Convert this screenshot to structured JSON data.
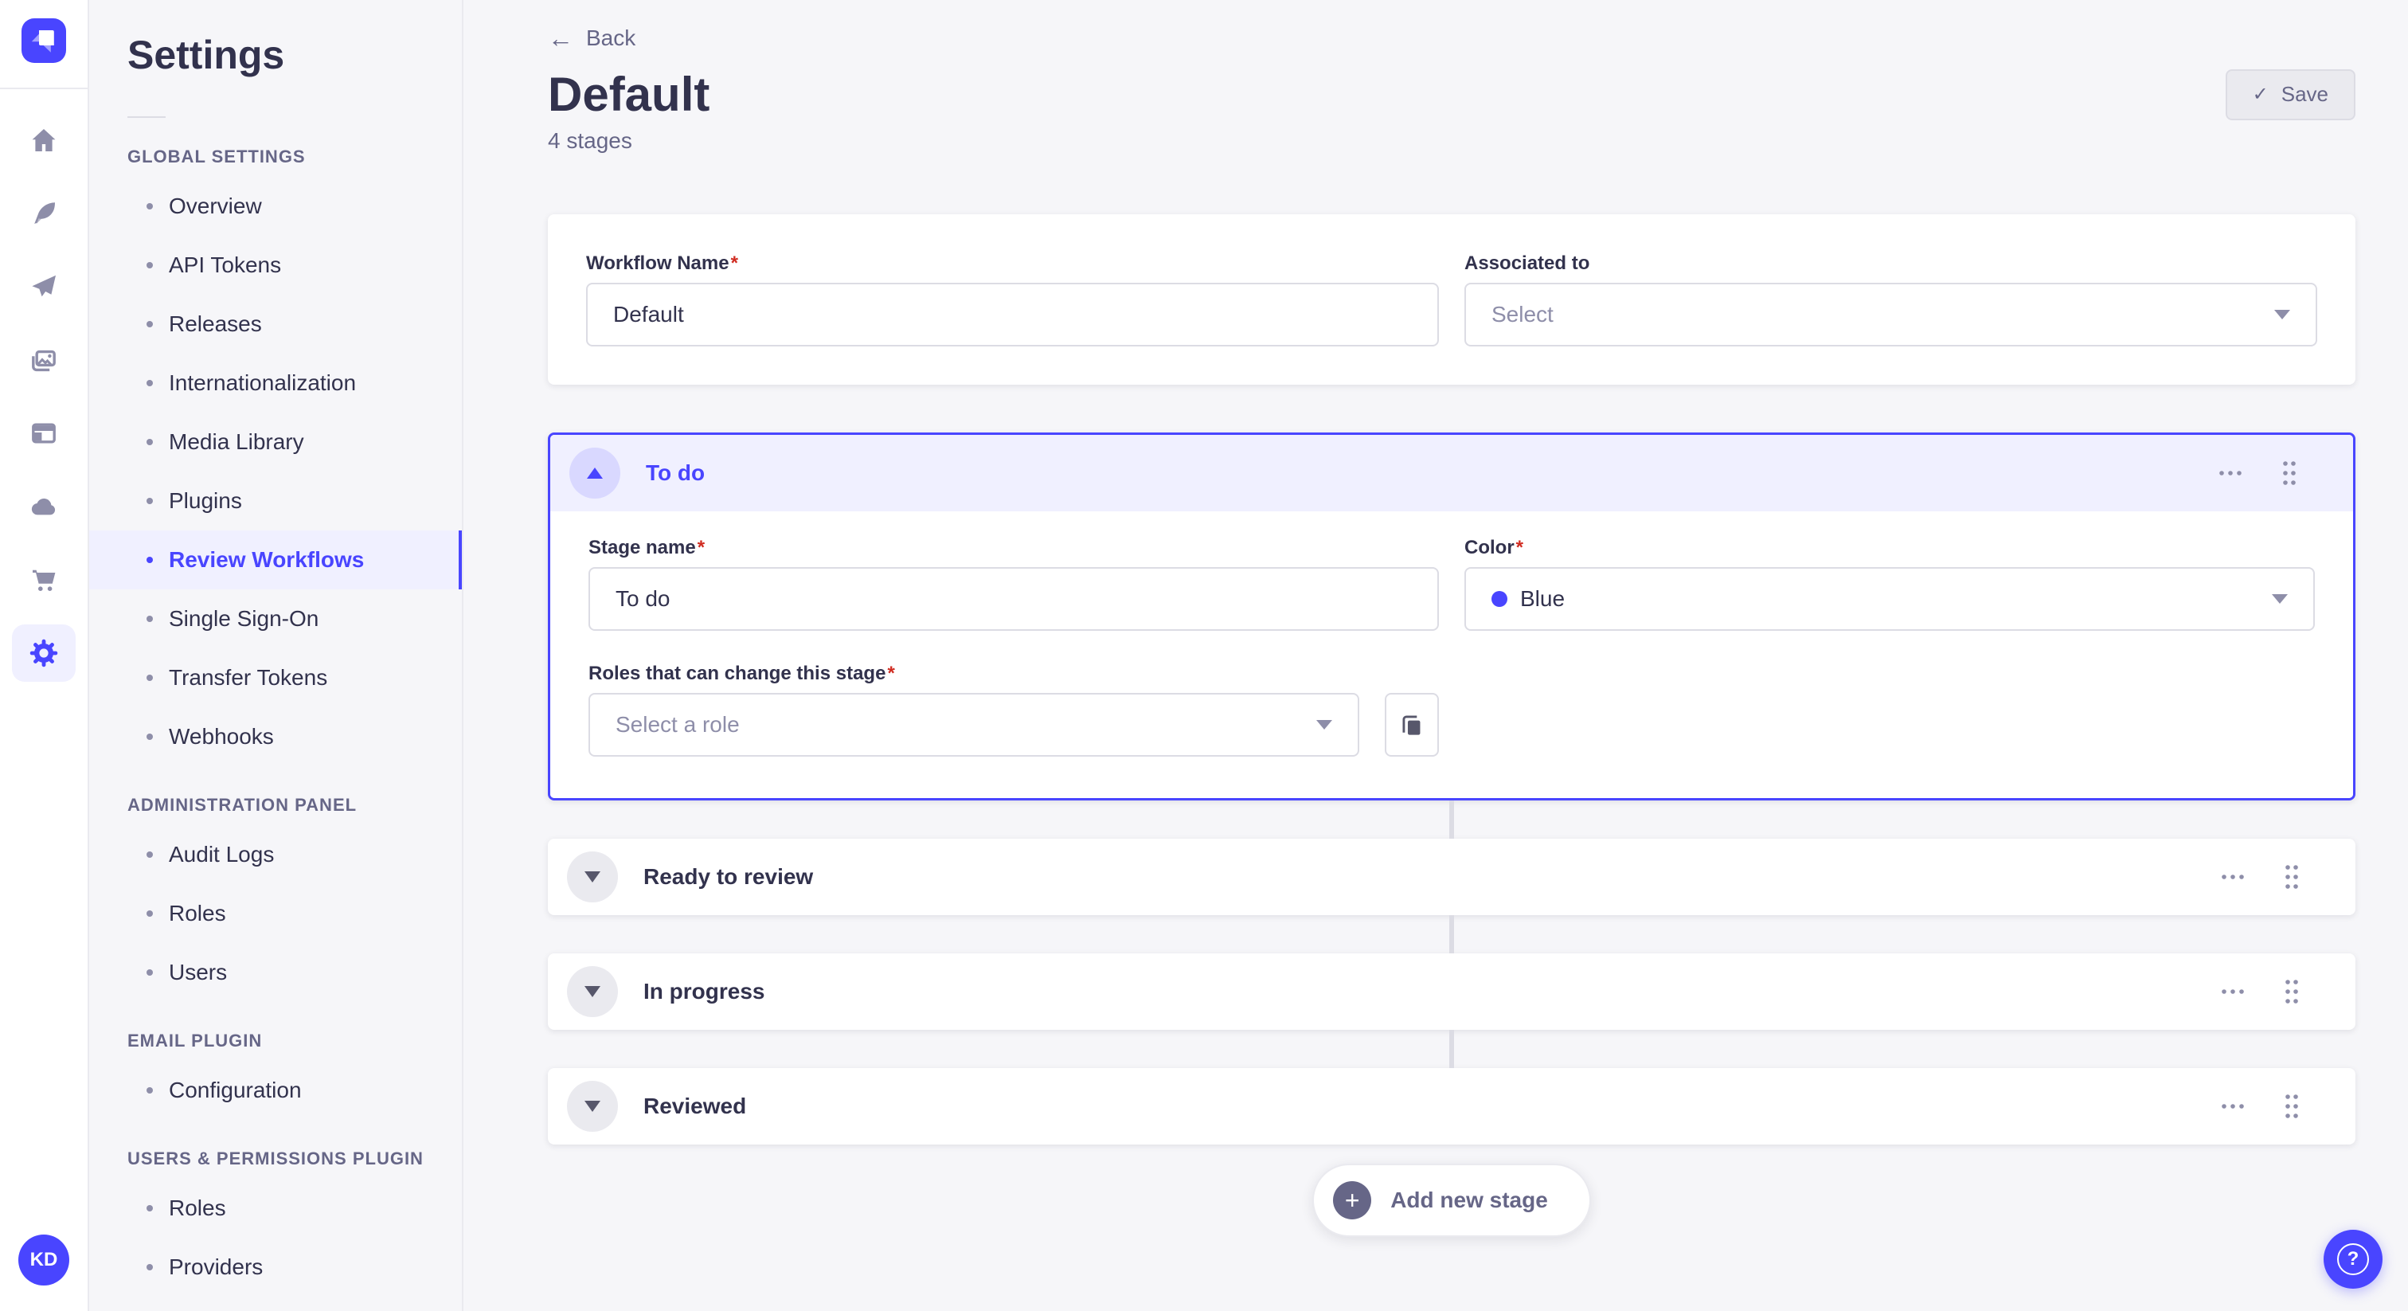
{
  "colors": {
    "primary": "#4945ff",
    "primary_highlight": "#f0f0ff",
    "danger_asterisk": "#d02b20",
    "text": "#32324d",
    "text_muted": "#666687",
    "border": "#dcdce4",
    "background": "#f6f6f9",
    "stage_color_dot": "#4945ff"
  },
  "rail": {
    "logo_icon": "strapi-logo",
    "nav_icons": [
      "home-icon",
      "feather-icon",
      "paper-plane-icon",
      "media-library-icon",
      "layout-icon",
      "cloud-icon",
      "cart-icon",
      "gear-icon"
    ],
    "active_icon": "gear-icon",
    "avatar_initials": "KD"
  },
  "sidebar": {
    "title": "Settings",
    "sections": [
      {
        "label": "GLOBAL SETTINGS",
        "items": [
          {
            "label": "Overview"
          },
          {
            "label": "API Tokens"
          },
          {
            "label": "Releases"
          },
          {
            "label": "Internationalization"
          },
          {
            "label": "Media Library"
          },
          {
            "label": "Plugins"
          },
          {
            "label": "Review Workflows",
            "active": true
          },
          {
            "label": "Single Sign-On"
          },
          {
            "label": "Transfer Tokens"
          },
          {
            "label": "Webhooks"
          }
        ]
      },
      {
        "label": "ADMINISTRATION PANEL",
        "items": [
          {
            "label": "Audit Logs"
          },
          {
            "label": "Roles"
          },
          {
            "label": "Users"
          }
        ]
      },
      {
        "label": "EMAIL PLUGIN",
        "items": [
          {
            "label": "Configuration"
          }
        ]
      },
      {
        "label": "USERS & PERMISSIONS PLUGIN",
        "items": [
          {
            "label": "Roles"
          },
          {
            "label": "Providers"
          }
        ]
      }
    ]
  },
  "header": {
    "back_label": "Back",
    "title": "Default",
    "subtitle": "4 stages",
    "save_label": "Save",
    "save_check": "✓"
  },
  "workflow_form": {
    "name_label": "Workflow Name",
    "name_required": "*",
    "name_value": "Default",
    "associated_label": "Associated to",
    "associated_value": "Select"
  },
  "stage_editor": {
    "header": "To do",
    "stage_name_label": "Stage name",
    "stage_name_required": "*",
    "stage_name_value": "To do",
    "color_label": "Color",
    "color_required": "*",
    "color_value": "Blue",
    "roles_label": "Roles that can change this stage",
    "roles_required": "*",
    "roles_placeholder": "Select a role"
  },
  "collapsed_stages": [
    {
      "name": "Ready to review"
    },
    {
      "name": "In progress"
    },
    {
      "name": "Reviewed"
    }
  ],
  "footer": {
    "add_stage_label": "Add new stage",
    "add_plus": "+",
    "help_label": "?"
  }
}
